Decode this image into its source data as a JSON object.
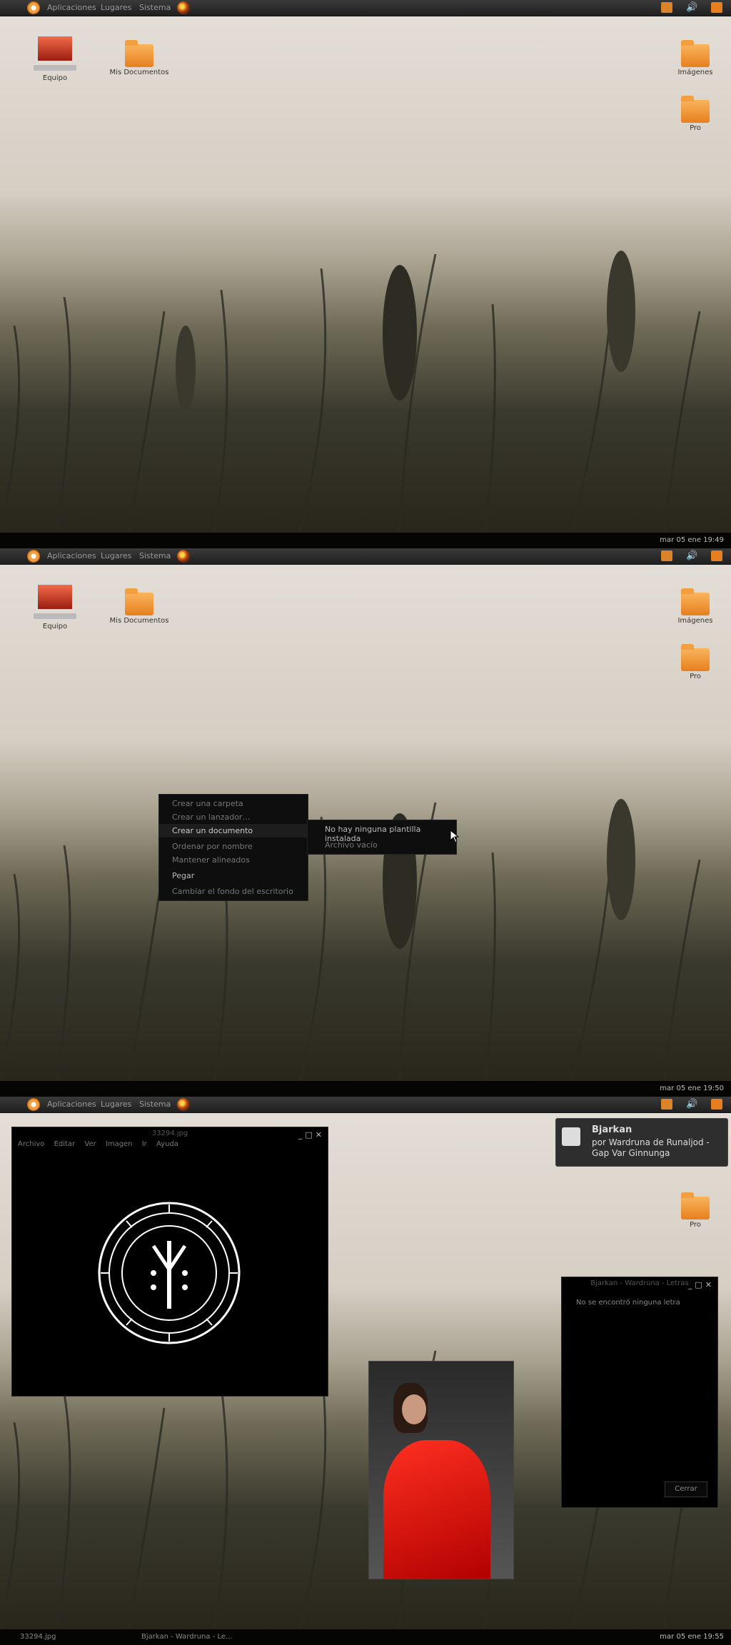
{
  "panel": {
    "menus": [
      "Aplicaciones",
      "Lugares",
      "Sistema"
    ]
  },
  "screens": [
    {
      "clock": "mar 05 ene  19:49"
    },
    {
      "clock": "mar 05 ene  19:50"
    },
    {
      "clock": "mar 05 ene  19:55"
    }
  ],
  "desktop_icons": {
    "equipo": "Equipo",
    "mis_documentos": "Mis Documentos",
    "imagenes": "Imágenes",
    "pro": "Pro"
  },
  "context_menu": {
    "items": [
      "Crear una carpeta",
      "Crear un lanzador…",
      "Crear un documento",
      "Ordenar por nombre",
      "Mantener alineados",
      "Pegar",
      "Cambiar el fondo del escritorio"
    ],
    "submenu": [
      "No hay ninguna plantilla instalada",
      "Archivo vacío"
    ]
  },
  "image_viewer": {
    "title": "33294.jpg",
    "menu": [
      "Archivo",
      "Editar",
      "Ver",
      "Imagen",
      "Ir",
      "Ayuda"
    ]
  },
  "notification": {
    "title": "Bjarkan",
    "body": "por Wardruna de Runaljod - Gap Var Ginnunga"
  },
  "lyrics_window": {
    "title": "Bjarkan - Wardruna - Letras",
    "message": "No se encontró ninguna letra",
    "close_label": "Cerrar"
  },
  "taskbar": {
    "items": [
      "33294.jpg",
      "Bjarkan - Wardruna - Le..."
    ],
    "clock": "mar 05 ene  19:55"
  },
  "colors": {
    "accent": "#e77f1f",
    "panel": "#2a2a2a"
  }
}
